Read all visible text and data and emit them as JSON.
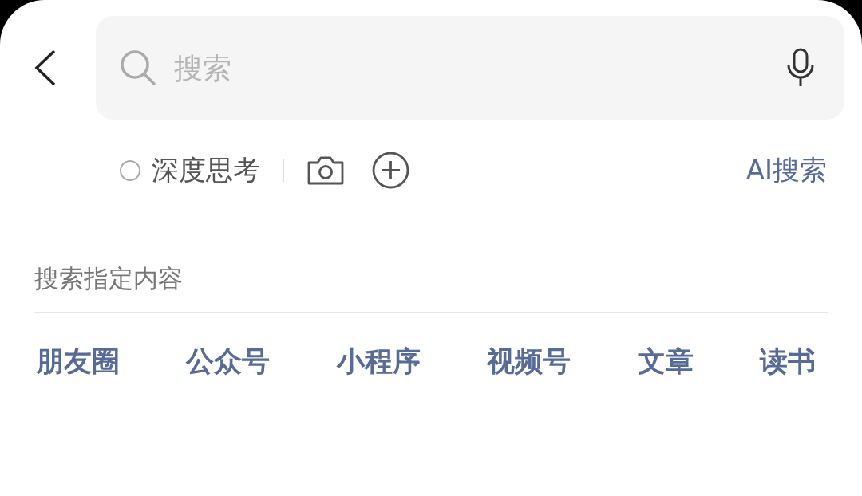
{
  "search": {
    "placeholder": "搜索"
  },
  "options": {
    "deep_thinking": {
      "label": "深度思考",
      "checked": false
    },
    "ai_search": "AI搜索"
  },
  "section": {
    "title": "搜索指定内容"
  },
  "categories": [
    {
      "label": "朋友圈"
    },
    {
      "label": "公众号"
    },
    {
      "label": "小程序"
    },
    {
      "label": "视频号"
    },
    {
      "label": "文章"
    },
    {
      "label": "读书"
    }
  ]
}
